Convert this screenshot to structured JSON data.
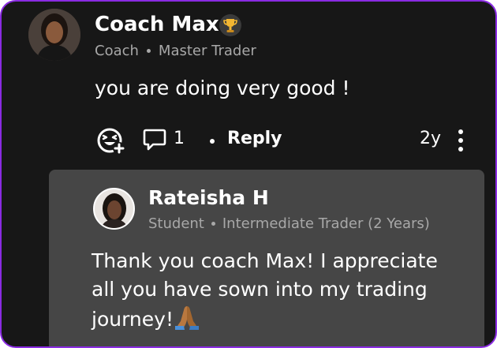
{
  "comment": {
    "author": "Coach Max",
    "badge_icon": "trophy-icon",
    "role": "Coach",
    "level": "Master Trader",
    "text": "you are doing very good !",
    "comment_count": "1",
    "reply_label": "Reply",
    "age": "2y"
  },
  "reply": {
    "author": "Rateisha H",
    "role": "Student",
    "level": "Intermediate Trader (2 Years)",
    "text": "Thank you coach Max! I appreciate all you have sown into my trading journey!",
    "emoji_icon": "praying-hands-icon"
  },
  "colors": {
    "background": "#171717",
    "reply_card": "#464646",
    "frame_border": "#8a2be2",
    "muted_text": "#a8a8a8"
  }
}
